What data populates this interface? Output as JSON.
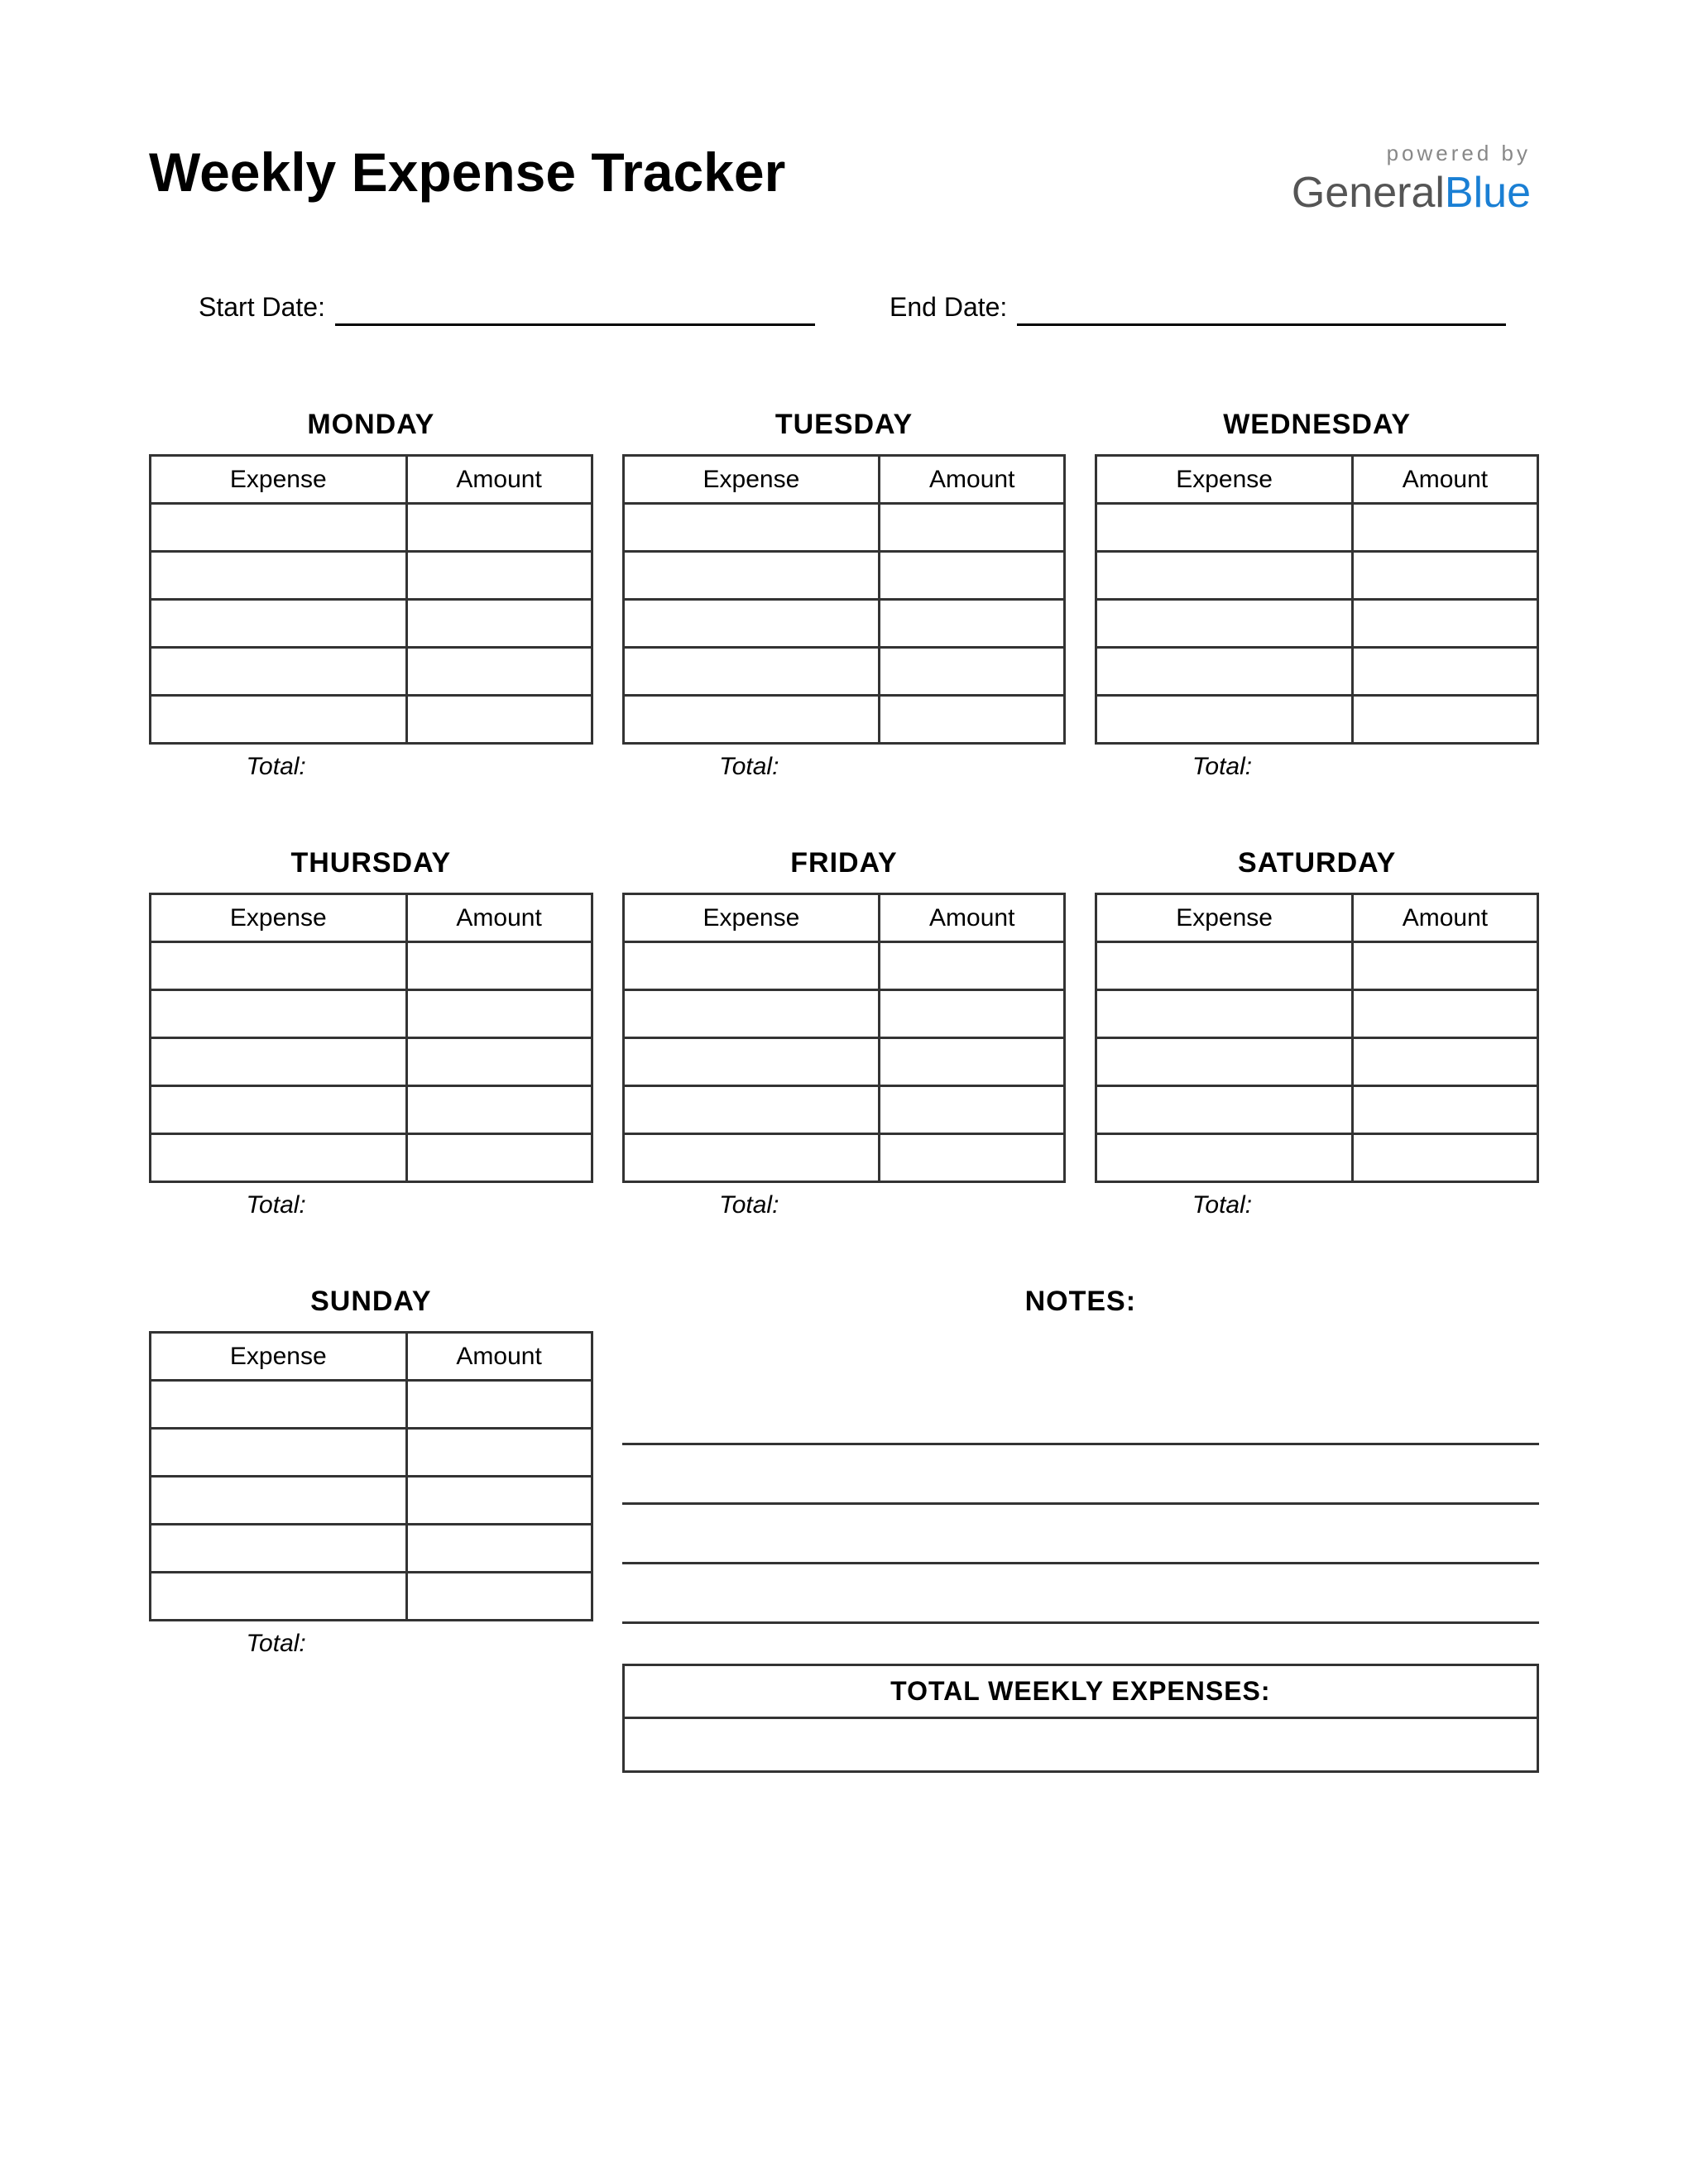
{
  "title": "Weekly Expense Tracker",
  "brand": {
    "powered": "powered by",
    "name1": "General",
    "name2": "Blue"
  },
  "dates": {
    "start_label": "Start Date:",
    "start_value": "",
    "end_label": "End Date:",
    "end_value": ""
  },
  "columns": {
    "expense": "Expense",
    "amount": "Amount"
  },
  "total_label": "Total:",
  "days": [
    {
      "name": "MONDAY",
      "rows": [
        [
          "",
          ""
        ],
        [
          "",
          ""
        ],
        [
          "",
          ""
        ],
        [
          "",
          ""
        ],
        [
          "",
          ""
        ]
      ],
      "total": ""
    },
    {
      "name": "TUESDAY",
      "rows": [
        [
          "",
          ""
        ],
        [
          "",
          ""
        ],
        [
          "",
          ""
        ],
        [
          "",
          ""
        ],
        [
          "",
          ""
        ]
      ],
      "total": ""
    },
    {
      "name": "WEDNESDAY",
      "rows": [
        [
          "",
          ""
        ],
        [
          "",
          ""
        ],
        [
          "",
          ""
        ],
        [
          "",
          ""
        ],
        [
          "",
          ""
        ]
      ],
      "total": ""
    },
    {
      "name": "THURSDAY",
      "rows": [
        [
          "",
          ""
        ],
        [
          "",
          ""
        ],
        [
          "",
          ""
        ],
        [
          "",
          ""
        ],
        [
          "",
          ""
        ]
      ],
      "total": ""
    },
    {
      "name": "FRIDAY",
      "rows": [
        [
          "",
          ""
        ],
        [
          "",
          ""
        ],
        [
          "",
          ""
        ],
        [
          "",
          ""
        ],
        [
          "",
          ""
        ]
      ],
      "total": ""
    },
    {
      "name": "SATURDAY",
      "rows": [
        [
          "",
          ""
        ],
        [
          "",
          ""
        ],
        [
          "",
          ""
        ],
        [
          "",
          ""
        ],
        [
          "",
          ""
        ]
      ],
      "total": ""
    },
    {
      "name": "SUNDAY",
      "rows": [
        [
          "",
          ""
        ],
        [
          "",
          ""
        ],
        [
          "",
          ""
        ],
        [
          "",
          ""
        ],
        [
          "",
          ""
        ]
      ],
      "total": ""
    }
  ],
  "notes": {
    "title": "NOTES:",
    "lines": [
      "",
      "",
      "",
      ""
    ]
  },
  "total_weekly": {
    "label": "TOTAL WEEKLY EXPENSES:",
    "value": ""
  }
}
